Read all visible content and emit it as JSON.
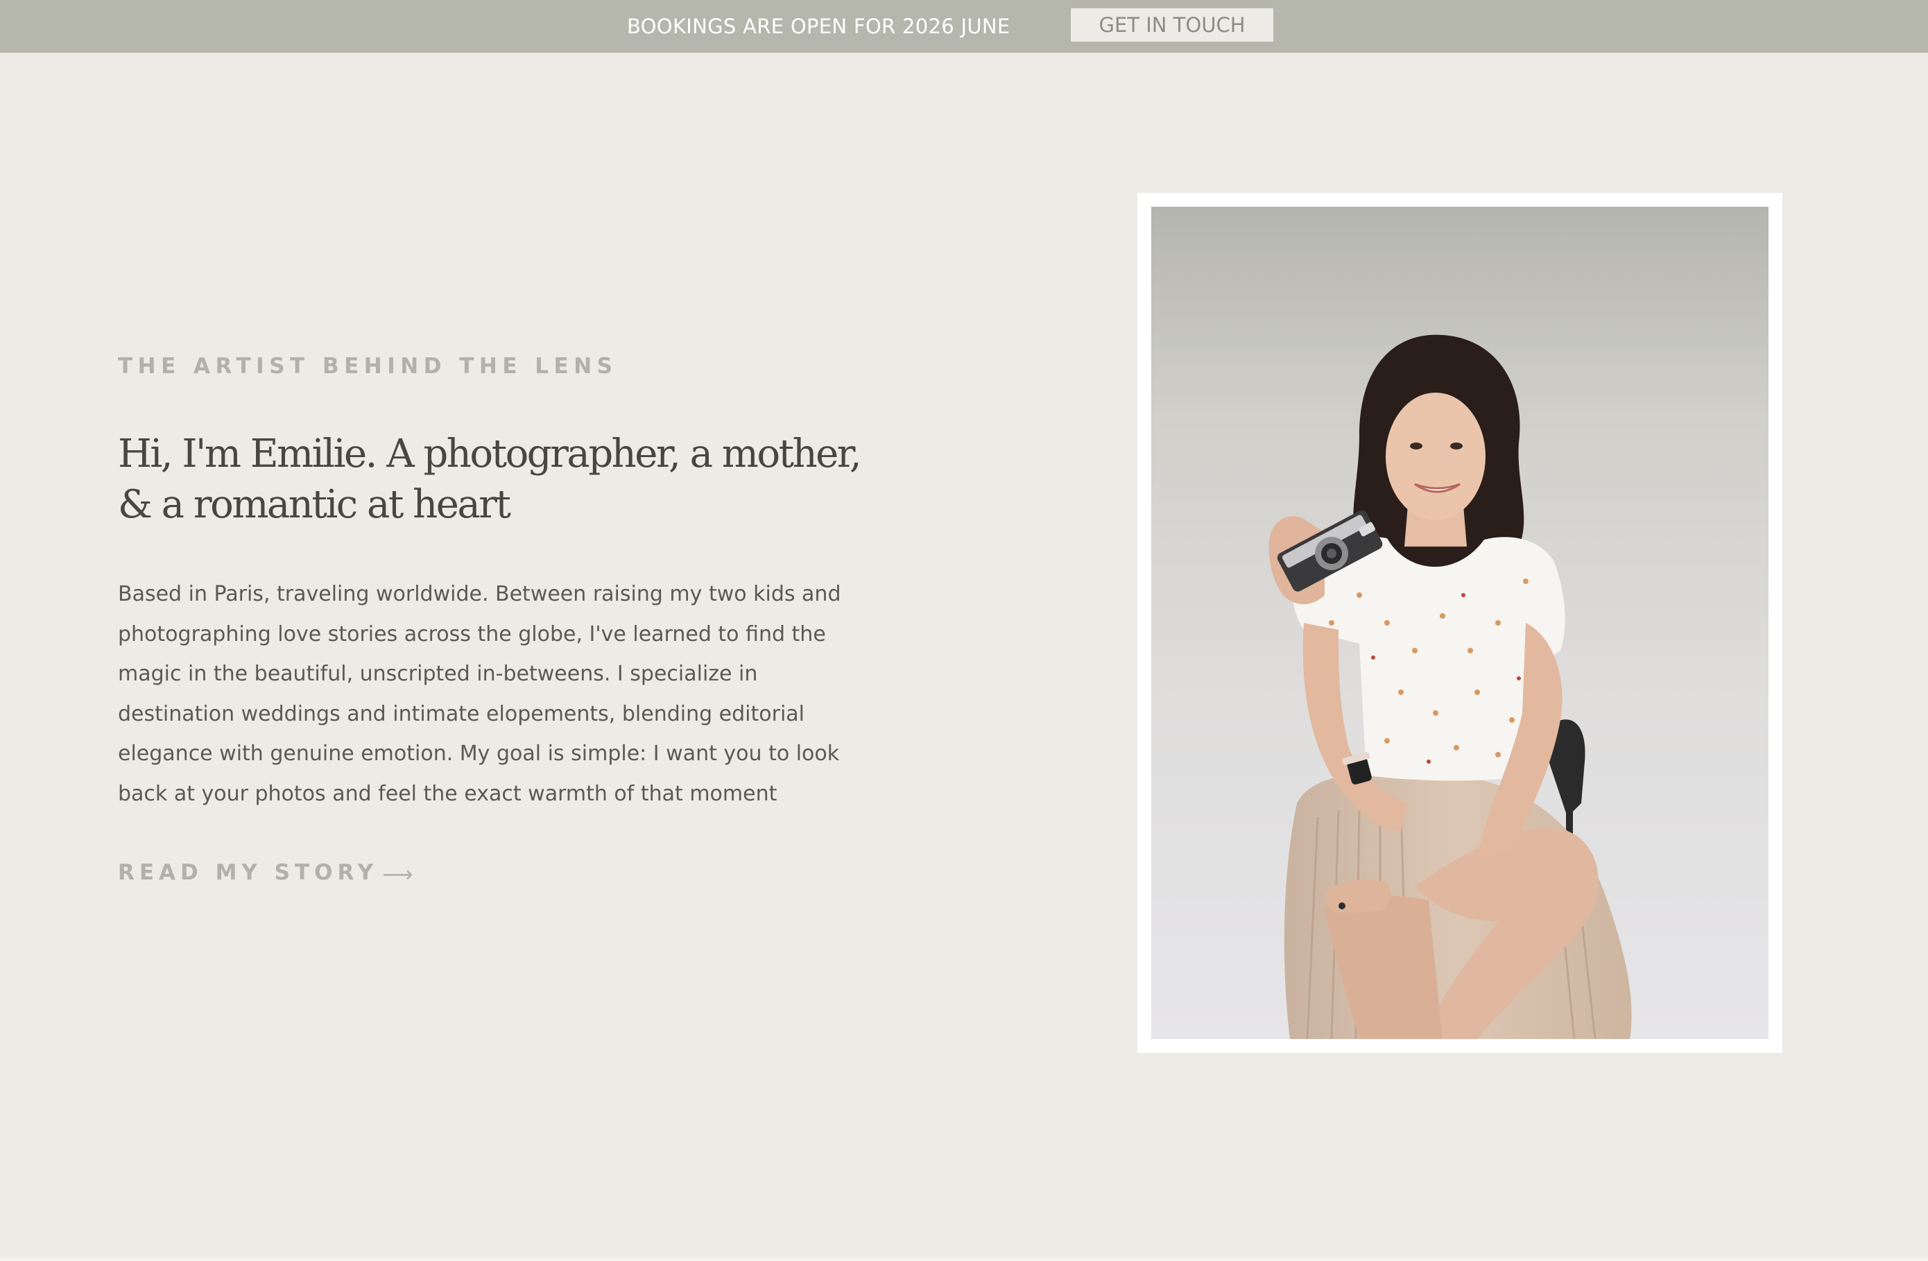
{
  "announcement_bar": {
    "text": "BOOKINGS ARE OPEN FOR 2026 JUNE",
    "button_label": "GET IN TOUCH"
  },
  "about": {
    "eyebrow": "THE ARTIST BEHIND THE LENS",
    "headline_lines": [
      "Hi, I'm Emilie. A photographer, a mother,",
      "&  a romantic at heart"
    ],
    "body_lines": [
      "Based in Paris, traveling worldwide. Between raising my two kids and",
      "photographing love stories across the globe, I've learned to find the",
      "magic in the beautiful, unscripted in-betweens. I specialize in",
      "destination weddings and intimate elopements, blending editorial",
      "elegance with genuine emotion. My goal is simple: I want you to look",
      "back at your photos and feel the exact warmth of that moment"
    ],
    "cta_label": "READ MY STORY",
    "cta_icon": "long-arrow-right-icon",
    "cta_arrow": "⟶"
  },
  "portrait": {
    "subject": "smiling woman with dark hair seated on a black chair, holding a vintage film camera",
    "frame_color": "#ffffff"
  },
  "colors": {
    "page_background": "#edebe6",
    "announcement_background": "#b5b6ac",
    "button_background": "#edebe6",
    "button_text": "#8d8c84",
    "heading_text": "#474643",
    "body_text": "#5a5955",
    "muted_label": "#b2b0aa"
  }
}
